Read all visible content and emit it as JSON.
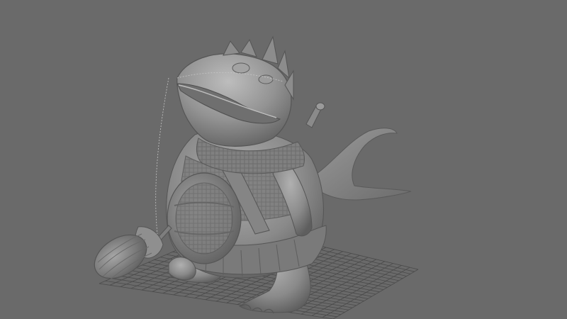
{
  "viewport": {
    "background": "#6a6a6a",
    "grid_color": "#4a4a4a",
    "model_color": "#8e8e8e",
    "model_shadow": "#5a5a5a",
    "model_highlight": "#b4b4b4",
    "wireframe_color": "#c8c8c8"
  }
}
